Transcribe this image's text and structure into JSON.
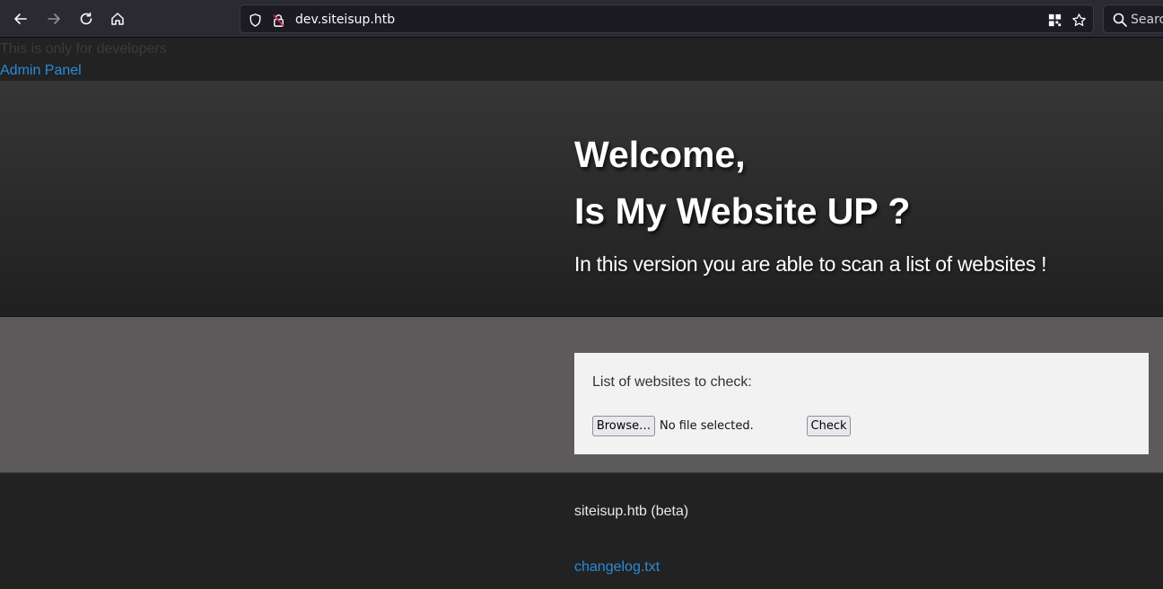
{
  "browser": {
    "url": "dev.siteisup.htb",
    "search_placeholder": "Search",
    "icon_color": "#fbfbfe",
    "disabled_icon_color": "#8f8f9d"
  },
  "page": {
    "dev_note": "This is only for developers",
    "admin_link": "Admin Panel",
    "hero": {
      "title_line1": "Welcome,",
      "title_line2": "Is My Website UP ?",
      "subtitle": "In this version you are able to scan a list of websites !"
    },
    "form": {
      "label": "List of websites to check:",
      "browse_label": "Browse…",
      "file_status": "No file selected.",
      "check_label": "Check"
    },
    "footer": {
      "brand": "siteisup.htb (beta)",
      "changelog_link": "changelog.txt"
    },
    "colors": {
      "link": "#2a8bd8",
      "hero_text": "#ffffff",
      "band_bg": "#5c5a5b"
    }
  }
}
